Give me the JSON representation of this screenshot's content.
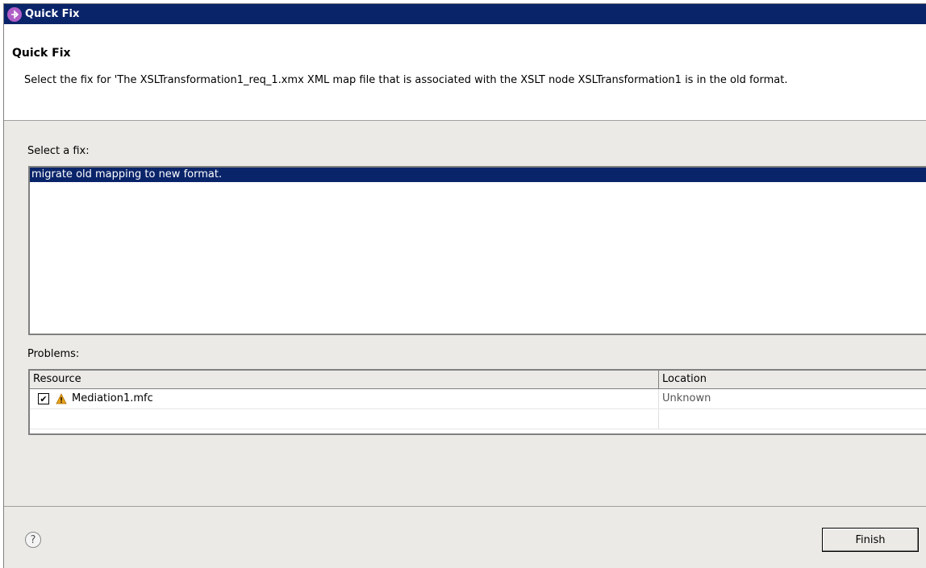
{
  "window": {
    "title": "Quick Fix"
  },
  "header": {
    "title": "Quick Fix",
    "description": "Select the fix for 'The XSLTransformation1_req_1.xmx XML map file that is associated with the XSLT node XSLTransformation1 is in the old format."
  },
  "fixes": {
    "label": "Select a fix:",
    "items": [
      "migrate old mapping to new format."
    ]
  },
  "problems": {
    "label": "Problems:",
    "columns": {
      "resource": "Resource",
      "location": "Location"
    },
    "rows": [
      {
        "checked": true,
        "resource": "Mediation1.mfc",
        "location": "Unknown"
      }
    ]
  },
  "footer": {
    "finish_label": "Finish",
    "help_symbol": "?"
  },
  "icons": {
    "title": "quick-fix-icon",
    "warning": "warning-icon",
    "help": "help-icon"
  },
  "colors": {
    "titlebar": "#0a246a",
    "selection": "#0a246a",
    "dialog_bg": "#eceae6",
    "warning": "#e8a317"
  }
}
